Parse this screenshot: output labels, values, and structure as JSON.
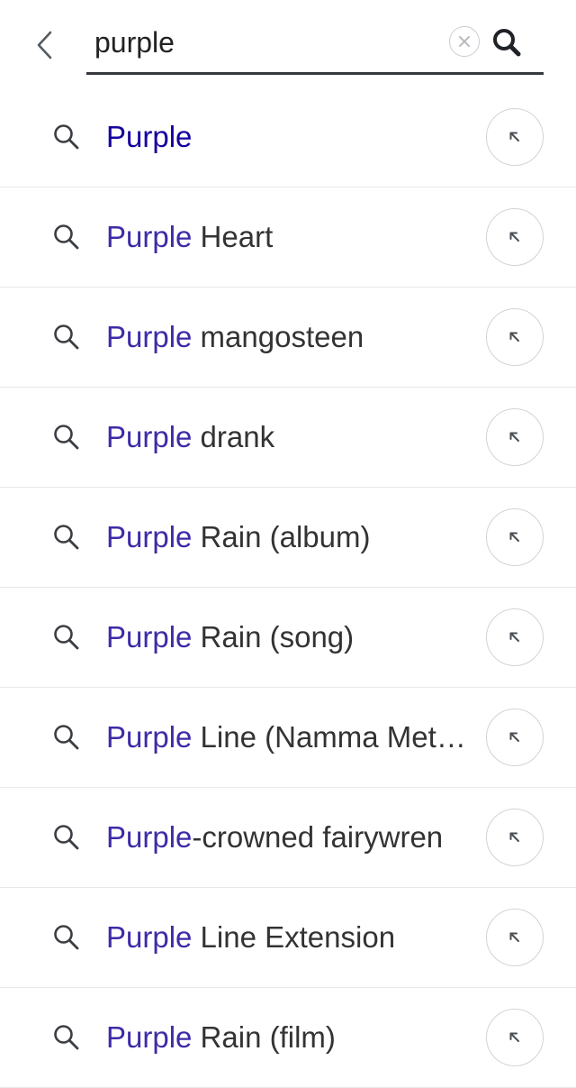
{
  "search": {
    "value": "purple",
    "back_icon": "chevron-left-icon",
    "clear_icon": "close-icon",
    "submit_icon": "search-icon"
  },
  "suggestions": [
    {
      "highlight": "Purple",
      "rest": "",
      "exact": true
    },
    {
      "highlight": "Purple",
      "rest": " Heart"
    },
    {
      "highlight": "Purple",
      "rest": " mangosteen"
    },
    {
      "highlight": "Purple",
      "rest": " drank"
    },
    {
      "highlight": "Purple",
      "rest": " Rain (album)"
    },
    {
      "highlight": "Purple",
      "rest": " Rain (song)"
    },
    {
      "highlight": "Purple",
      "rest": " Line (Namma Metro)"
    },
    {
      "highlight": "Purple",
      "rest": "-crowned fairywren"
    },
    {
      "highlight": "Purple",
      "rest": " Line Extension"
    },
    {
      "highlight": "Purple",
      "rest": " Rain (film)"
    }
  ],
  "row_icons": {
    "search": "search-icon",
    "fill": "arrow-up-left-icon"
  },
  "colors": {
    "highlight": "#3d2ba8",
    "exact_match": "#14009e",
    "text": "#333333",
    "divider": "#e6e8eb"
  }
}
